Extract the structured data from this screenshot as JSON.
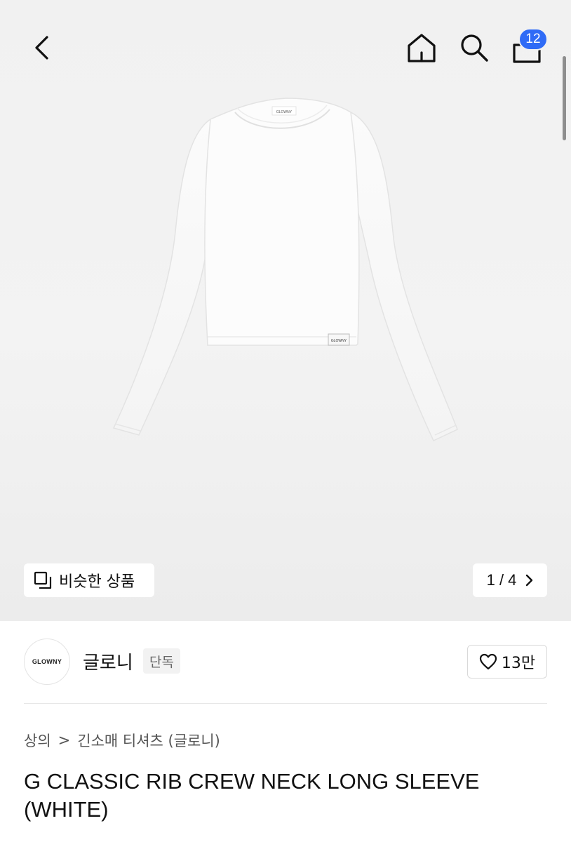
{
  "header": {
    "back_icon": "chevron-left-icon",
    "home_icon": "home-icon",
    "search_icon": "search-icon",
    "cart_icon": "shopping-bag-icon",
    "cart_count": "12",
    "badge_color": "#2f6bf6"
  },
  "gallery": {
    "similar_label": "비슷한 상품",
    "similar_icon": "copy-squares-icon",
    "pager_label": "1 / 4",
    "pager_icon": "chevron-right-icon",
    "garment_label_text": "GLOWNY"
  },
  "brand": {
    "logo_text": "GLOWNY",
    "name": "글로니",
    "tag": "단독",
    "like_count": "13만",
    "like_icon": "heart-outline-icon"
  },
  "breadcrumb": {
    "items": [
      "상의",
      "긴소매 티셔츠 (글로니)"
    ],
    "separator": ">"
  },
  "product": {
    "title": "G CLASSIC RIB CREW NECK LONG SLEEVE (WHITE)"
  }
}
